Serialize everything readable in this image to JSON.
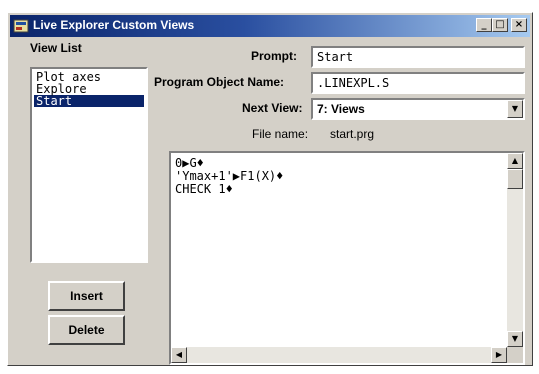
{
  "window": {
    "title": "Live Explorer Custom Views",
    "icon": "app-icon",
    "controls": {
      "minimize": "_",
      "maximize": "□",
      "close": "×"
    }
  },
  "view_list": {
    "label": "View List",
    "items": [
      {
        "label": "Plot axes",
        "selected": false
      },
      {
        "label": "Explore",
        "selected": false
      },
      {
        "label": "Start",
        "selected": true
      }
    ]
  },
  "buttons": {
    "insert": "Insert",
    "delete": "Delete"
  },
  "form": {
    "prompt_label": "Prompt:",
    "prompt_value": "Start",
    "program_label": "Program Object Name:",
    "program_value": ".LINEXPL.S",
    "next_view_label": "Next View:",
    "next_view_value": "7: Views",
    "file_name_label": "File name:",
    "file_name_value": "start.prg"
  },
  "editor": {
    "lines": [
      "0▶G♦",
      "'Ymax+1'▶F1(X)♦",
      "CHECK 1♦"
    ]
  },
  "colors": {
    "title_start": "#0a246a",
    "title_end": "#a6caf0",
    "selection": "#0a246a",
    "face": "#d4d0c8"
  }
}
